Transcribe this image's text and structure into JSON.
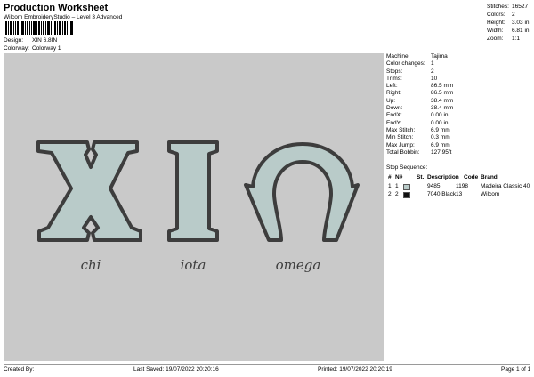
{
  "header": {
    "title": "Production Worksheet",
    "subtitle": "Wilcom EmbroideryStudio – Level 3 Advanced"
  },
  "meta": [
    {
      "label": "Design:",
      "value": "XIN 6.8IN"
    },
    {
      "label": "Colorway:",
      "value": "Colorway 1"
    }
  ],
  "stats": [
    {
      "label": "Stitches:",
      "value": "16527"
    },
    {
      "label": "Colors:",
      "value": "2"
    },
    {
      "label": "Height:",
      "value": "3.03 in"
    },
    {
      "label": "Width:",
      "value": "6.81 in"
    },
    {
      "label": "Zoom:",
      "value": "1:1"
    }
  ],
  "machine_info": [
    {
      "label": "Machine:",
      "value": "Tajima"
    },
    {
      "label": "Color changes:",
      "value": "1"
    },
    {
      "label": "Stops:",
      "value": "2"
    },
    {
      "label": "Trims:",
      "value": "10"
    },
    {
      "label": "Left:",
      "value": "86.5 mm"
    },
    {
      "label": "Right:",
      "value": "86.5 mm"
    },
    {
      "label": "Up:",
      "value": "38.4 mm"
    },
    {
      "label": "Down:",
      "value": "38.4 mm"
    },
    {
      "label": "EndX:",
      "value": "0.00 in"
    },
    {
      "label": "EndY:",
      "value": "0.00 in"
    },
    {
      "label": "Max Stitch:",
      "value": "6.9 mm"
    },
    {
      "label": "Min Stitch:",
      "value": "0.3 mm"
    },
    {
      "label": "Max Jump:",
      "value": "6.9 mm"
    },
    {
      "label": "Total Bobbin:",
      "value": "127.95ft"
    }
  ],
  "stop_sequence": {
    "title": "Stop Sequence:",
    "headers": {
      "num": "#",
      "n": "N#",
      "st": "St.",
      "description": "Description",
      "code": "Code",
      "brand": "Brand"
    },
    "rows": [
      {
        "num": "1.",
        "n": "1",
        "color": "#b9cbc9",
        "name": "9485",
        "st": "1198",
        "code": "",
        "brand": "Madeira Classic 40"
      },
      {
        "num": "2.",
        "n": "2",
        "color": "#111111",
        "name": "7040 Black",
        "st": "13",
        "code": "",
        "brand": "Wilcom"
      }
    ]
  },
  "design": {
    "letters": [
      "X",
      "I",
      "Ω"
    ],
    "captions": [
      "chi",
      "iota",
      "omega"
    ],
    "fill_color": "#b9cbc9",
    "outline_color": "#3d3d3d",
    "background": "#c9c9c9"
  },
  "footer": {
    "created_by": "Created By:",
    "last_saved": "Last Saved: 19/07/2022 20:20:16",
    "printed": "Printed: 19/07/2022 20:20:19",
    "page": "Page 1 of 1"
  }
}
